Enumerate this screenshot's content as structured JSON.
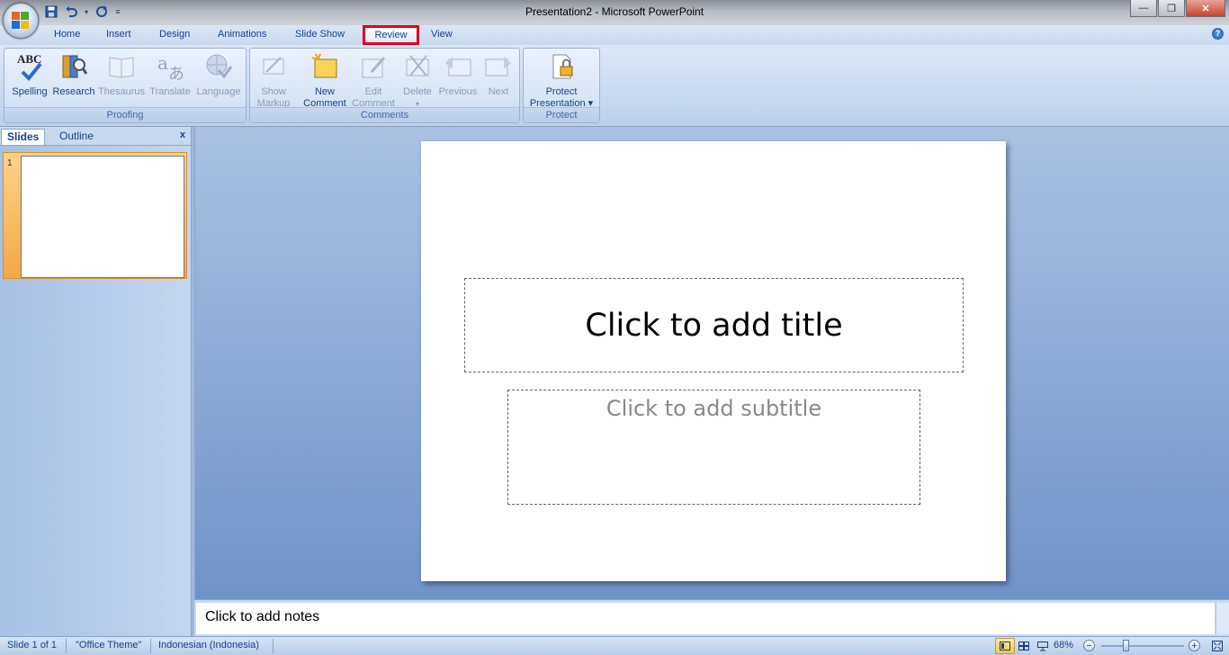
{
  "window": {
    "title": "Presentation2 - Microsoft PowerPoint",
    "controls": {
      "minimize": "—",
      "maximize": "❐",
      "close": "✕"
    }
  },
  "quick_access": {
    "save_icon": "save-icon",
    "undo_icon": "undo-icon",
    "redo_icon": "redo-icon"
  },
  "tabs": [
    {
      "label": "Home"
    },
    {
      "label": "Insert"
    },
    {
      "label": "Design"
    },
    {
      "label": "Animations"
    },
    {
      "label": "Slide Show"
    },
    {
      "label": "Review",
      "active": true
    },
    {
      "label": "View"
    }
  ],
  "help": "?",
  "ribbon": {
    "proofing": {
      "label": "Proofing",
      "buttons": [
        "Spelling",
        "Research",
        "Thesaurus",
        "Translate",
        "Language"
      ]
    },
    "comments": {
      "label": "Comments",
      "show_markup": [
        "Show",
        "Markup"
      ],
      "new_comment": [
        "New",
        "Comment"
      ],
      "edit_comment": [
        "Edit",
        "Comment"
      ],
      "delete": "Delete",
      "previous": "Previous",
      "next": "Next"
    },
    "protect": {
      "label": "Protect",
      "protect_presentation": [
        "Protect",
        "Presentation ▾"
      ]
    },
    "spelling_icon_text": "ABC"
  },
  "slides_pane": {
    "tabs": [
      "Slides",
      "Outline"
    ],
    "close": "x",
    "thumbnails": [
      {
        "number": "1"
      }
    ]
  },
  "slide": {
    "title_placeholder": "Click to add title",
    "subtitle_placeholder": "Click to add subtitle"
  },
  "notes": {
    "placeholder": "Click to add notes"
  },
  "status_bar": {
    "slide_info": "Slide 1 of 1",
    "theme": "\"Office Theme\"",
    "language": "Indonesian (Indonesia)",
    "zoom": "68%",
    "zoom_minus": "−",
    "zoom_plus": "+"
  },
  "colors": {
    "accent": "#15428b",
    "active_tab_highlight": "#e00020",
    "thumb_selected": "#f5a845"
  }
}
